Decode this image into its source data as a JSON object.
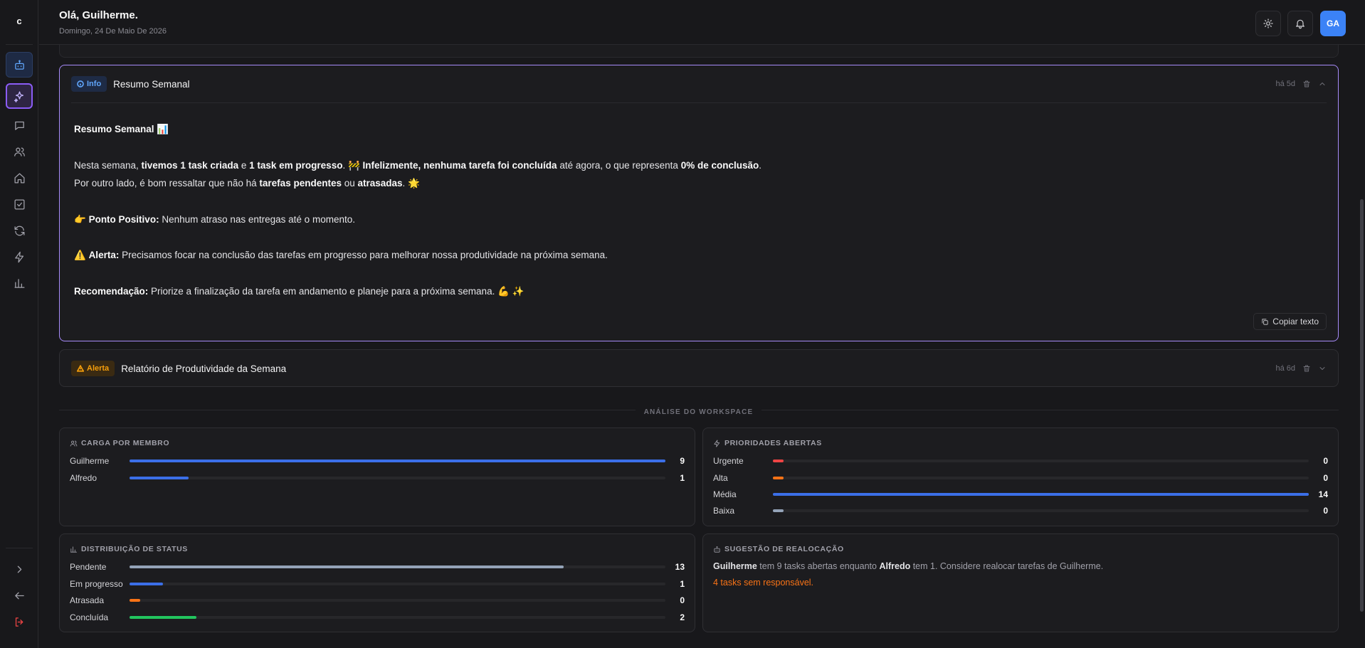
{
  "sidebar": {
    "logo": "c",
    "items": [
      {
        "icon": "bot-icon"
      },
      {
        "icon": "sparkles-icon"
      },
      {
        "icon": "message-icon"
      },
      {
        "icon": "users-icon"
      },
      {
        "icon": "home-icon"
      },
      {
        "icon": "check-square-icon"
      },
      {
        "icon": "refresh-icon"
      },
      {
        "icon": "zap-icon"
      },
      {
        "icon": "bar-chart-icon"
      }
    ],
    "bottom": [
      {
        "icon": "chevron-right-icon"
      },
      {
        "icon": "arrow-left-icon"
      },
      {
        "icon": "logout-icon"
      }
    ]
  },
  "header": {
    "greeting": "Olá, Guilherme.",
    "date": "Domingo, 24 De Maio De 2026",
    "avatar": "GA"
  },
  "cards": [
    {
      "badge": "Info",
      "title": "Resumo Semanal",
      "age": "há 5d",
      "expanded": true,
      "body": {
        "heading": "Resumo Semanal 📊",
        "p1_a": "Nesta semana, ",
        "p1_b": "tivemos 1 task criada",
        "p1_c": " e ",
        "p1_d": "1 task em progresso",
        "p1_e": ". 🚧 ",
        "p1_f": "Infelizmente, nenhuma tarefa foi concluída",
        "p1_g": " até agora, o que representa ",
        "p1_h": "0% de conclusão",
        "p1_i": ".",
        "p2_a": "Por outro lado, é bom ressaltar que não há ",
        "p2_b": "tarefas pendentes",
        "p2_c": " ou ",
        "p2_d": "atrasadas",
        "p2_e": ". 🌟",
        "p3_a": "👉 ",
        "p3_b": "Ponto Positivo:",
        "p3_c": " Nenhum atraso nas entregas até o momento.",
        "p4_a": "⚠️ ",
        "p4_b": "Alerta:",
        "p4_c": " Precisamos focar na conclusão das tarefas em progresso para melhorar nossa produtividade na próxima semana.",
        "p5_b": "Recomendação:",
        "p5_c": " Priorize a finalização da tarefa em andamento e planeje para a próxima semana. 💪 ✨"
      },
      "copy_label": "Copiar texto"
    },
    {
      "badge": "Alerta",
      "title": "Relatório de Produtividade da Semana",
      "age": "há 6d",
      "expanded": false
    }
  ],
  "section_label": "ANÁLISE DO WORKSPACE",
  "panels": {
    "carga": {
      "title": "CARGA POR MEMBRO",
      "rows": [
        {
          "label": "Guilherme",
          "value": 9,
          "fraction": 1.0,
          "color": "#3b6fe8"
        },
        {
          "label": "Alfredo",
          "value": 1,
          "fraction": 0.11,
          "color": "#3b6fe8"
        }
      ]
    },
    "prioridades": {
      "title": "PRIORIDADES ABERTAS",
      "rows": [
        {
          "label": "Urgente",
          "value": 0,
          "fraction": 0.02,
          "color": "#ef4444"
        },
        {
          "label": "Alta",
          "value": 0,
          "fraction": 0.02,
          "color": "#f97316"
        },
        {
          "label": "Média",
          "value": 14,
          "fraction": 1.0,
          "color": "#3b6fe8"
        },
        {
          "label": "Baixa",
          "value": 0,
          "fraction": 0.02,
          "color": "#94a3b8"
        }
      ]
    },
    "status": {
      "title": "DISTRIBUIÇÃO DE STATUS",
      "rows": [
        {
          "label": "Pendente",
          "value": 13,
          "fraction": 0.81,
          "color": "#94a3b8"
        },
        {
          "label": "Em progresso",
          "value": 1,
          "fraction": 0.063,
          "color": "#3b6fe8"
        },
        {
          "label": "Atrasada",
          "value": 0,
          "fraction": 0.02,
          "color": "#f97316"
        },
        {
          "label": "Concluída",
          "value": 2,
          "fraction": 0.125,
          "color": "#22c55e"
        }
      ]
    },
    "realocacao": {
      "title": "SUGESTÃO DE REALOCAÇÃO",
      "name1": "Guilherme",
      "text1": " tem 9 tasks abertas enquanto ",
      "name2": "Alfredo",
      "text2": " tem 1. Considere realocar tarefas de Guilherme.",
      "warning": "4 tasks sem responsável."
    }
  }
}
